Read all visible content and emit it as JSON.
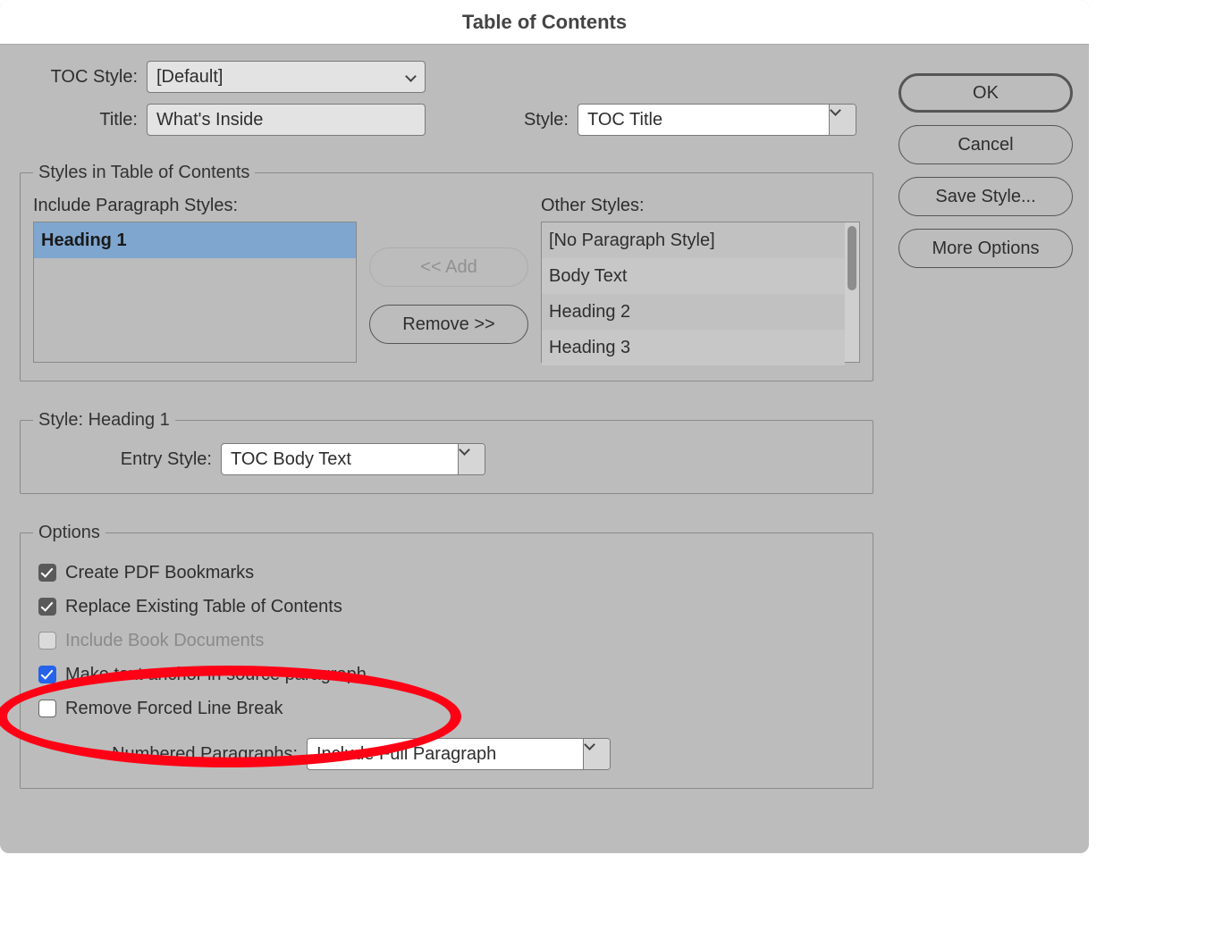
{
  "window_title": "Table of Contents",
  "top": {
    "toc_style_label": "TOC Style:",
    "toc_style_value": "[Default]",
    "title_label": "Title:",
    "title_value": "What's Inside",
    "style_label": "Style:",
    "style_value": "TOC Title"
  },
  "styles_group": {
    "legend": "Styles in Table of Contents",
    "include_label": "Include Paragraph Styles:",
    "other_label": "Other Styles:",
    "include_items": [
      "Heading 1"
    ],
    "other_items": [
      "[No Paragraph Style]",
      "Body Text",
      "Heading 2",
      "Heading 3"
    ],
    "add_btn": "<< Add",
    "remove_btn": "Remove >>"
  },
  "entry_group": {
    "legend": "Style: Heading 1",
    "entry_style_label": "Entry Style:",
    "entry_style_value": "TOC Body Text"
  },
  "options_group": {
    "legend": "Options",
    "create_pdf": "Create PDF Bookmarks",
    "replace_existing": "Replace Existing Table of Contents",
    "include_book": "Include Book Documents",
    "text_anchor": "Make text anchor in source paragraph",
    "remove_forced": "Remove Forced Line Break",
    "numbered_label": "Numbered Paragraphs:",
    "numbered_value": "Include Full Paragraph"
  },
  "buttons": {
    "ok": "OK",
    "cancel": "Cancel",
    "save_style": "Save Style...",
    "more_options": "More Options"
  }
}
